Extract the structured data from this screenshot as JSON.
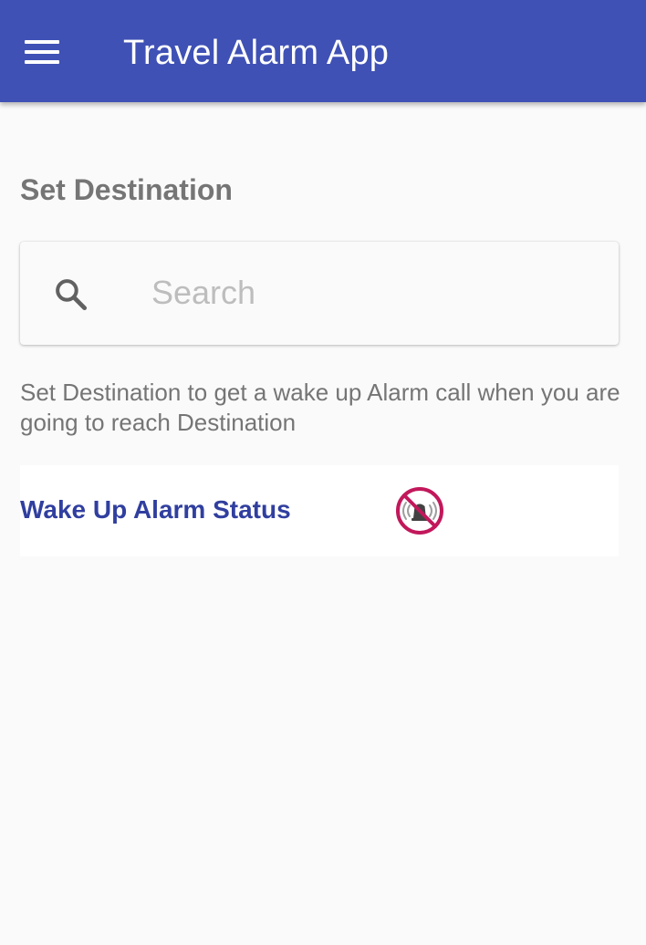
{
  "appbar": {
    "menu_icon": "hamburger-menu-icon",
    "title": "Travel Alarm App",
    "color": "#3f51b5"
  },
  "destination": {
    "heading": "Set Destination",
    "search": {
      "icon": "search-icon",
      "placeholder": "Search",
      "value": ""
    },
    "helper_text": "Set Destination to get a wake up Alarm call when you are going to reach Destination"
  },
  "alarm_status": {
    "label": "Wake Up Alarm Status",
    "icon": "alarm-off-icon",
    "state": "off",
    "accent_color": "#303f9f",
    "icon_color": "#c2185b"
  }
}
